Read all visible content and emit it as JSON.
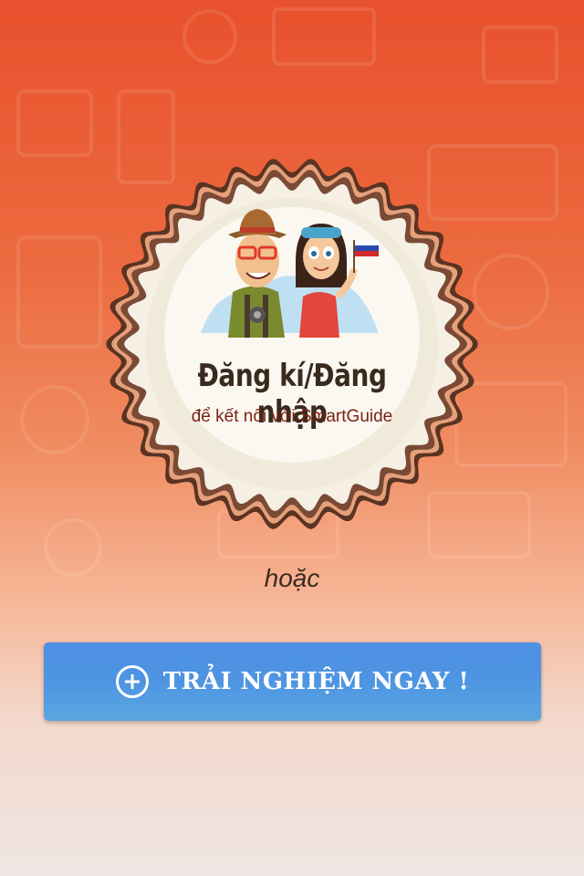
{
  "badge": {
    "title": "Đăng kí/Đăng nhập",
    "subtitle": "để kết nối với SmartGuide"
  },
  "separator": {
    "text": "hoặc"
  },
  "cta": {
    "label": "TRẢI NGHIỆM NGAY !",
    "icon": "plus-circle-icon"
  },
  "colors": {
    "background_top": "#e8512d",
    "background_bottom": "#efe6e3",
    "button": "#4e95e2",
    "badge_ring": "#7a4a35",
    "badge_fill": "#f2ede2"
  }
}
